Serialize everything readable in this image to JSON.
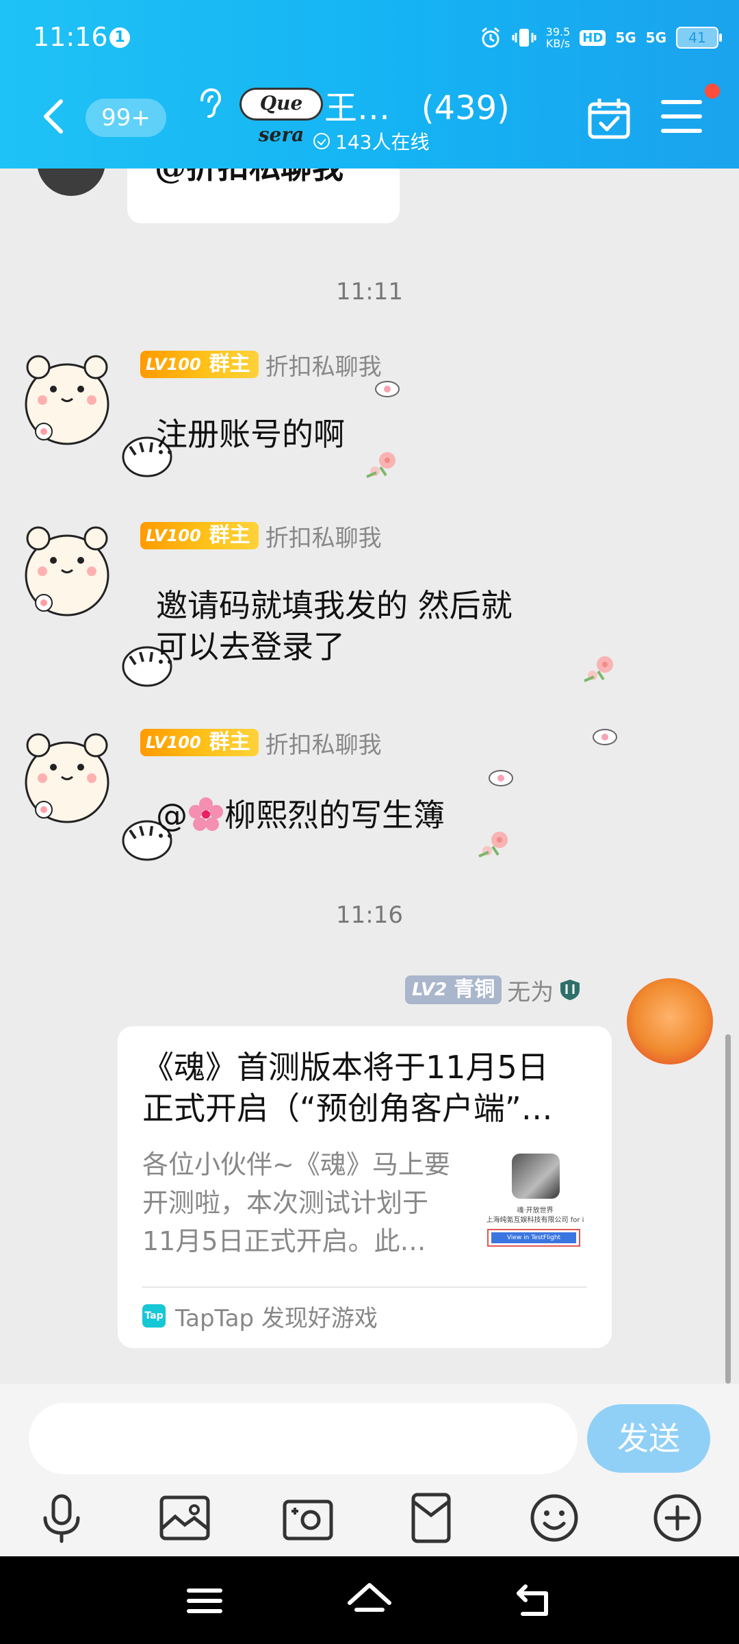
{
  "status_bar": {
    "time": "11:16",
    "notification_count": "1",
    "net_speed_value": "39.5",
    "net_speed_unit": "KB/s",
    "hd_label": "HD",
    "signal1": "5G",
    "signal2": "5G",
    "battery": "41"
  },
  "header": {
    "unread_count": "99+",
    "group_logo_text": "Que sera",
    "group_name": "王…",
    "member_count": "(439)",
    "online_text": "143人在线"
  },
  "messages": {
    "top_partial_text": "@折扣私聊我",
    "time1": "11:11",
    "m1": {
      "level": "LV100",
      "role": "群主",
      "sender": "折扣私聊我",
      "text": "注册账号的啊"
    },
    "m2": {
      "level": "LV100",
      "role": "群主",
      "sender": "折扣私聊我",
      "text_line1": "邀请码就填我发的  然后就",
      "text_line2": "可以去登录了"
    },
    "m3": {
      "level": "LV100",
      "role": "群主",
      "sender": "折扣私聊我",
      "text_prefix": "@",
      "text_rest": "柳熙烈的写生簿"
    },
    "time2": "11:16",
    "own": {
      "level": "LV2",
      "rank": "青铜",
      "name": "无为",
      "card_title_line1": "《魂》首测版本将于11月5日",
      "card_title_line2": "正式开启（“预创角客户端”…",
      "card_desc_line1": "各位小伙伴~《魂》马上要",
      "card_desc_line2": "开测啦，本次测试计划于",
      "card_desc_line3": "11月5日正式开启。此…",
      "thumb_line1": "魂·开放世界",
      "thumb_line2": "上海纯氪互娱科技有限公司 for i",
      "thumb_button": "View in TestFlight",
      "source_icon": "Tap",
      "source": "TapTap 发现好游戏"
    }
  },
  "input": {
    "placeholder": "",
    "send_label": "发送"
  },
  "toolbar": [
    "microphone-icon",
    "image-icon",
    "camera-icon",
    "red-packet-icon",
    "emoji-icon",
    "plus-icon"
  ],
  "colors": {
    "header": "#15b3f3",
    "send": "#90d0f7",
    "owner_badge": "#ffae10",
    "bronze_badge": "#aab6cc"
  }
}
